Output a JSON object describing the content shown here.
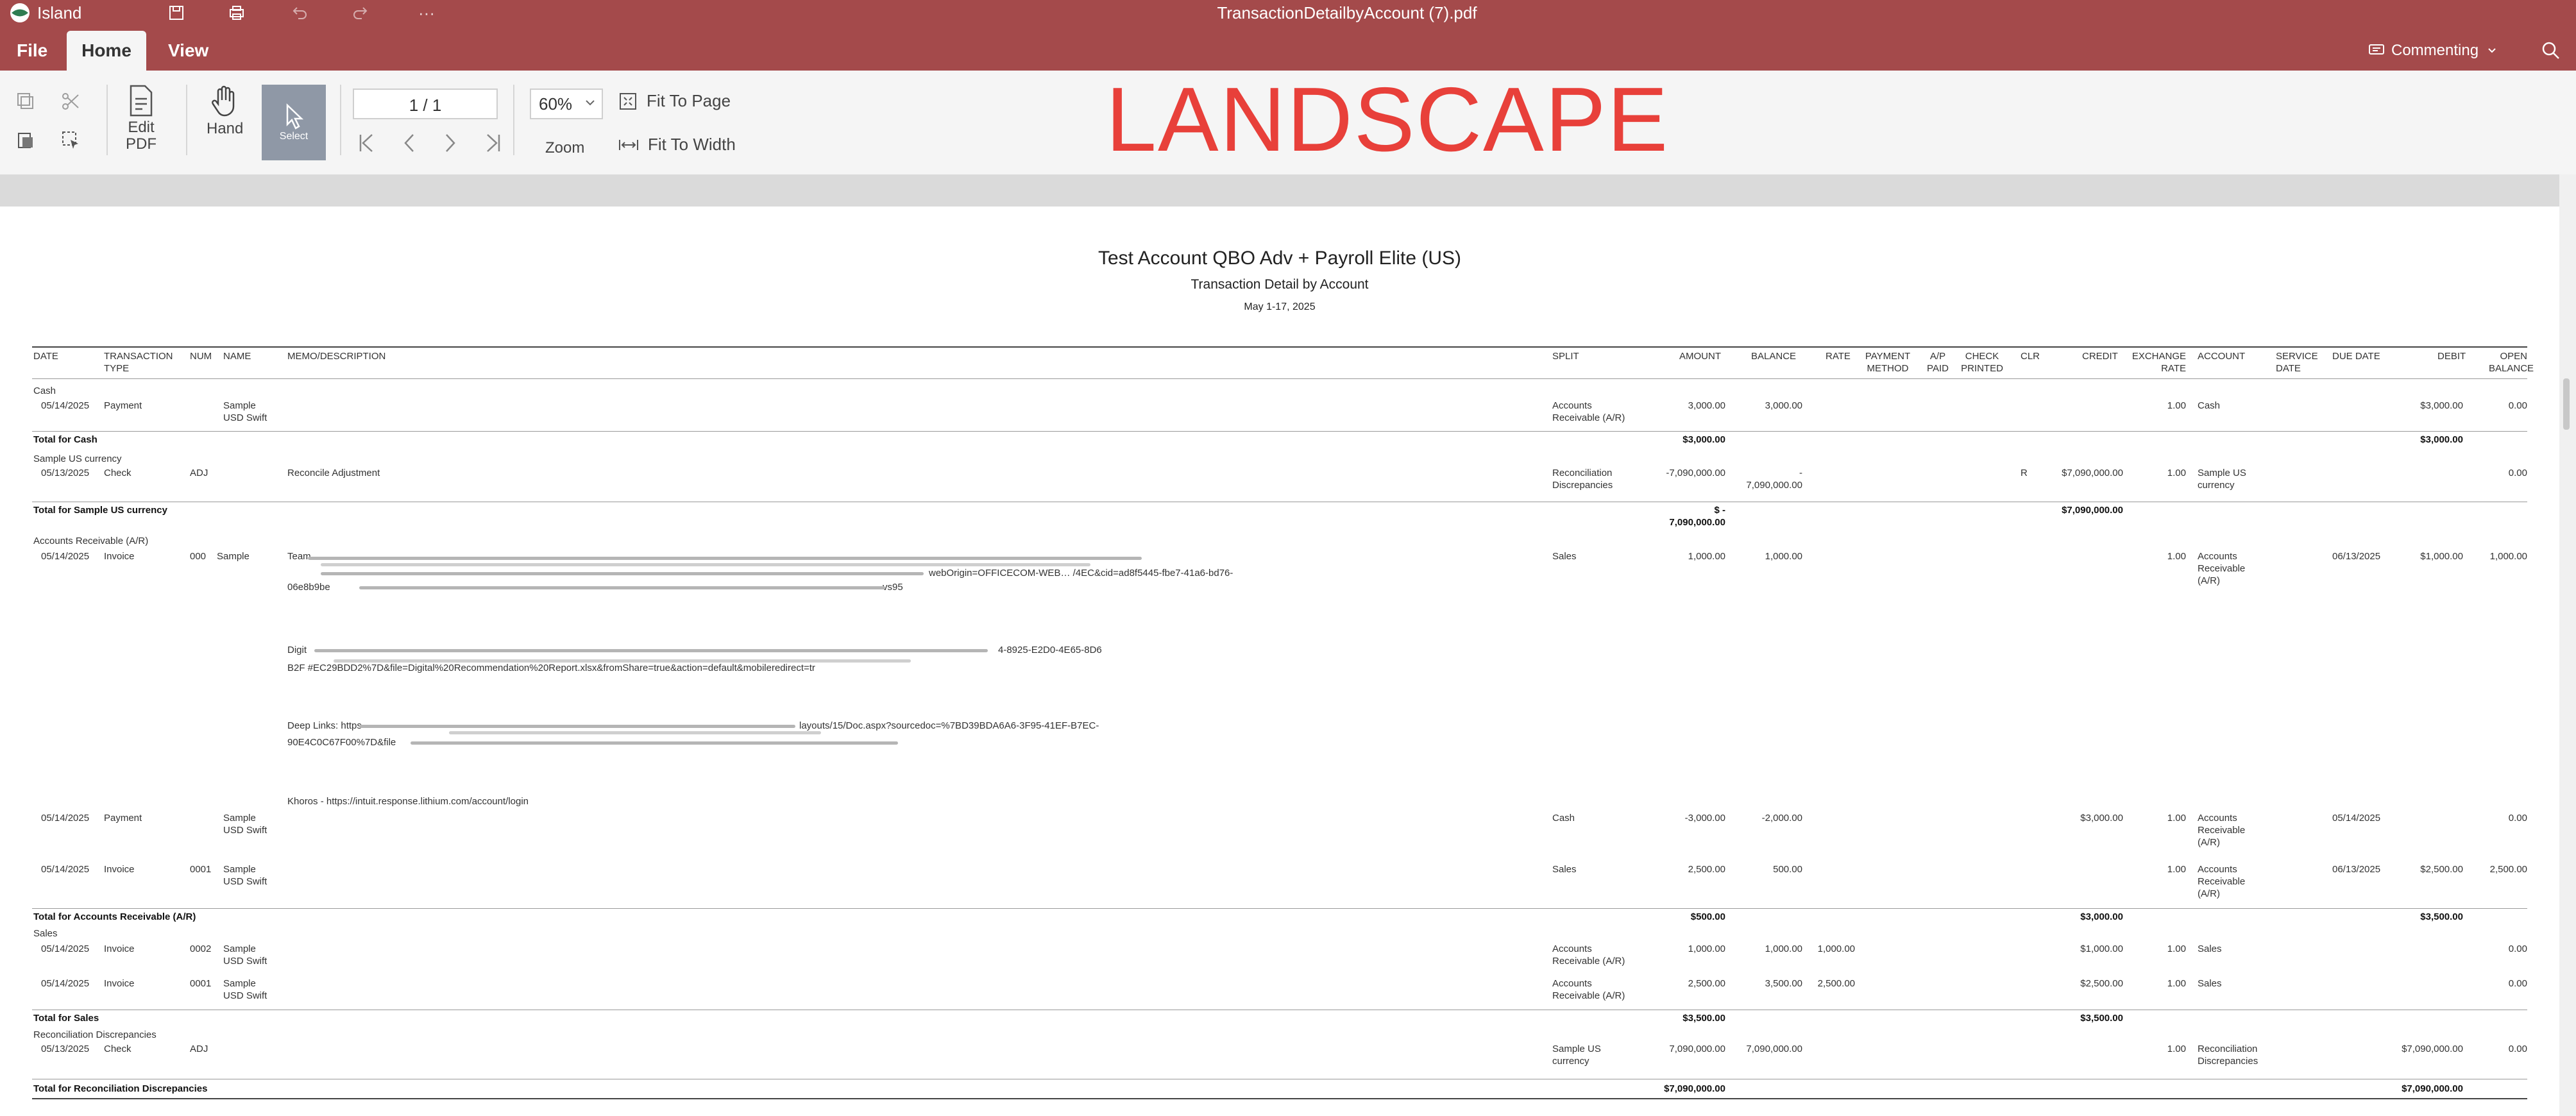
{
  "titlebar": {
    "app_name": "Island",
    "document_title": "TransactionDetailbyAccount (7).pdf",
    "more": "···"
  },
  "menu": {
    "tabs": [
      "File",
      "Home",
      "View"
    ],
    "active": "Home",
    "commenting": "Commenting"
  },
  "toolbar": {
    "edit_pdf": "Edit\nPDF",
    "hand": "Hand",
    "select": "Select",
    "page_value": "1 / 1",
    "zoom_value": "60%",
    "zoom": "Zoom",
    "fit_to_page": "Fit To Page",
    "fit_to_width": "Fit To Width"
  },
  "annotation": "LANDSCAPE",
  "report": {
    "title": "Test Account QBO Adv + Payroll Elite (US)",
    "subtitle": "Transaction Detail by Account",
    "date_range": "May 1-17, 2025",
    "columns": [
      "DATE",
      "TRANSACTION TYPE",
      "NUM",
      "NAME",
      "MEMO/DESCRIPTION",
      "SPLIT",
      "AMOUNT",
      "BALANCE",
      "RATE",
      "PAYMENT METHOD",
      "A/P PAID",
      "CHECK PRINTED",
      "CLR",
      "CREDIT",
      "EXCHANGE RATE",
      "ACCOUNT",
      "SERVICE DATE",
      "DUE DATE",
      "DEBIT",
      "OPEN BALANCE"
    ],
    "sections": {
      "cash": "Cash",
      "cash_total": "Total for Cash",
      "sample": "Sample US currency",
      "sample_total": "Total for Sample US currency",
      "ar": "Accounts Receivable (A/R)",
      "ar_total": "Total for Accounts Receivable (A/R)",
      "sales": "Sales",
      "sales_total": "Total for Sales",
      "recon": "Reconciliation Discrepancies",
      "recon_total": "Total for Reconciliation Discrepancies"
    },
    "rows": {
      "r1": {
        "date": "05/14/2025",
        "type": "Payment",
        "name": "Sample\nUSD Swift",
        "split": "Accounts\nReceivable (A/R)",
        "amount": "3,000.00",
        "balance": "3,000.00",
        "exch": "1.00",
        "account": "Cash",
        "debit": "$3,000.00",
        "open": "0.00"
      },
      "cash_total": {
        "amount": "$3,000.00",
        "debit": "$3,000.00"
      },
      "r2": {
        "date": "05/13/2025",
        "type": "Check",
        "num": "ADJ",
        "memo": "Reconcile Adjustment",
        "split": "Reconciliation\nDiscrepancies",
        "amount": "-7,090,000.00",
        "balance": "-\n7,090,000.00",
        "clr": "R",
        "credit": "$7,090,000.00",
        "exch": "1.00",
        "account": "Sample US\ncurrency",
        "open": "0.00"
      },
      "sample_total": {
        "amount": "$ -\n7,090,000.00",
        "credit": "$7,090,000.00"
      },
      "r3": {
        "date": "05/14/2025",
        "type": "Invoice",
        "num": "000",
        "name": "Sample",
        "memo1": "Team",
        "memo1b": "webOrigin=OFFICECOM-WEB… /4EC&cid=ad8f5445-fbe7-41a6-bd76-",
        "memo1c": "06e8b9be",
        "memo1d": "vs95",
        "memo2a": "Digit",
        "memo2b": "4-8925-E2D0-4E65-8D6",
        "memo2c": "B2F #EC29BDD2%7D&file=Digital%20Recommendation%20Report.xlsx&fromShare=true&action=default&mobileredirect=tr",
        "memo3a": "Deep Links: https",
        "memo3b": "layouts/15/Doc.aspx?sourcedoc=%7BD39BDA6A6-3F95-41EF-B7EC-",
        "memo3c": "90E4C0C67F00%7D&file",
        "memo4": "Khoros - https://intuit.response.lithium.com/account/login",
        "split": "Sales",
        "amount": "1,000.00",
        "balance": "1,000.00",
        "exch": "1.00",
        "account": "Accounts\nReceivable\n(A/R)",
        "due": "06/13/2025",
        "debit": "$1,000.00",
        "open": "1,000.00"
      },
      "r4": {
        "date": "05/14/2025",
        "type": "Payment",
        "name": "Sample\nUSD Swift",
        "split": "Cash",
        "amount": "-3,000.00",
        "balance": "-2,000.00",
        "credit": "$3,000.00",
        "exch": "1.00",
        "account": "Accounts\nReceivable\n(A/R)",
        "due": "05/14/2025",
        "open": "0.00"
      },
      "r5": {
        "date": "05/14/2025",
        "type": "Invoice",
        "num": "0001",
        "name": "Sample\nUSD Swift",
        "split": "Sales",
        "amount": "2,500.00",
        "balance": "500.00",
        "exch": "1.00",
        "account": "Accounts\nReceivable\n(A/R)",
        "due": "06/13/2025",
        "debit": "$2,500.00",
        "open": "2,500.00"
      },
      "ar_total": {
        "amount": "$500.00",
        "credit": "$3,000.00",
        "debit": "$3,500.00"
      },
      "r6": {
        "date": "05/14/2025",
        "type": "Invoice",
        "num": "0002",
        "name": "Sample\nUSD Swift",
        "split": "Accounts\nReceivable (A/R)",
        "amount": "1,000.00",
        "balance": "1,000.00",
        "rate": "1,000.00",
        "credit": "$1,000.00",
        "exch": "1.00",
        "account": "Sales",
        "open": "0.00"
      },
      "r7": {
        "date": "05/14/2025",
        "type": "Invoice",
        "num": "0001",
        "name": "Sample\nUSD Swift",
        "split": "Accounts\nReceivable (A/R)",
        "amount": "2,500.00",
        "balance": "3,500.00",
        "rate": "2,500.00",
        "credit": "$2,500.00",
        "exch": "1.00",
        "account": "Sales",
        "open": "0.00"
      },
      "sales_total": {
        "amount": "$3,500.00",
        "credit": "$3,500.00"
      },
      "r8": {
        "date": "05/13/2025",
        "type": "Check",
        "num": "ADJ",
        "split": "Sample US\ncurrency",
        "amount": "7,090,000.00",
        "balance": "7,090,000.00",
        "exch": "1.00",
        "account": "Reconciliation\nDiscrepancies",
        "debit": "$7,090,000.00",
        "open": "0.00"
      },
      "recon_total": {
        "amount": "$7,090,000.00",
        "debit": "$7,090,000.00"
      }
    }
  },
  "colors": {
    "titlebar": "#a44a4b",
    "annotation": "#e8403a",
    "select_active": "#8f98a6"
  },
  "icons": [
    "globe-icon",
    "save-icon",
    "print-icon",
    "undo-icon",
    "redo-icon",
    "copy-icon",
    "scissors-icon",
    "paste-icon",
    "select-area-icon",
    "edit-pdf-icon",
    "hand-icon",
    "cursor-icon",
    "first-page-icon",
    "prev-page-icon",
    "next-page-icon",
    "last-page-icon",
    "fit-page-icon",
    "fit-width-icon",
    "comment-icon",
    "search-icon",
    "chevron-down-icon"
  ]
}
